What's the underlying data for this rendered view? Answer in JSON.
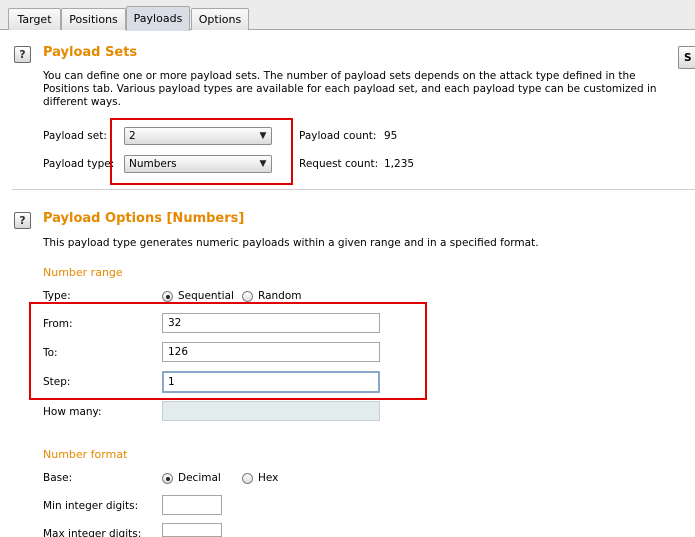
{
  "tabs": [
    "Target",
    "Positions",
    "Payloads",
    "Options"
  ],
  "payload_sets": {
    "title": "Payload Sets",
    "description": "You can define one or more payload sets. The number of payload sets depends on the attack type defined in the Positions tab. Various payload types are available for each payload set, and each payload type can be customized in different ways.",
    "payload_set_label": "Payload set:",
    "payload_set_value": "2",
    "payload_type_label": "Payload type:",
    "payload_type_value": "Numbers",
    "payload_count_label": "Payload count:",
    "payload_count_value": "95",
    "request_count_label": "Request count:",
    "request_count_value": "1,235",
    "side_button_label": "S"
  },
  "payload_options": {
    "title": "Payload Options [Numbers]",
    "description": "This payload type generates numeric payloads within a given range and in a specified format.",
    "number_range_title": "Number range",
    "type_label": "Type:",
    "type_sequential": "Sequential",
    "type_random": "Random",
    "from_label": "From:",
    "from_value": "32",
    "to_label": "To:",
    "to_value": "126",
    "step_label": "Step:",
    "step_value": "1",
    "how_many_label": "How many:",
    "how_many_value": "",
    "number_format_title": "Number format",
    "base_label": "Base:",
    "base_decimal": "Decimal",
    "base_hex": "Hex",
    "min_integer_label": "Min integer digits:",
    "min_integer_value": "",
    "max_integer_label": "Max integer digits:",
    "max_integer_value": ""
  },
  "colors": {
    "accent": "#e58900",
    "highlight": "#e00000"
  }
}
